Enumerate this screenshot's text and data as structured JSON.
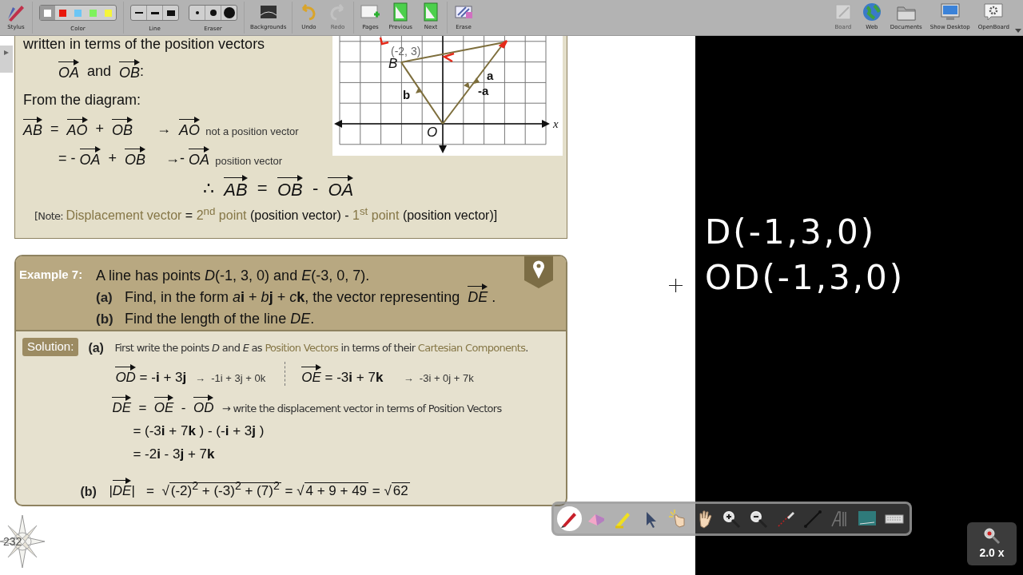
{
  "toolbar": {
    "left": [
      {
        "kind": "stylus",
        "label": "Stylus",
        "disabled": false
      },
      {
        "kind": "color",
        "label": "Color",
        "options": [
          {
            "color": "#ffffff",
            "selected": true
          },
          {
            "color": "#e8180c",
            "selected": false
          },
          {
            "color": "#6cc6f5",
            "selected": false
          },
          {
            "color": "#7ef25c",
            "selected": false
          },
          {
            "color": "#f5f53a",
            "selected": false
          }
        ]
      },
      {
        "kind": "line",
        "label": "Line"
      },
      {
        "kind": "eraser",
        "label": "Eraser"
      },
      {
        "kind": "backgrounds",
        "label": "Backgrounds",
        "disabled": false
      },
      {
        "kind": "undo",
        "label": "Undo",
        "disabled": false
      },
      {
        "kind": "redo",
        "label": "Redo",
        "disabled": true
      },
      {
        "kind": "pages",
        "label": "Pages",
        "disabled": false
      },
      {
        "kind": "previous",
        "label": "Previous",
        "disabled": false
      },
      {
        "kind": "next",
        "label": "Next",
        "disabled": false
      },
      {
        "kind": "erase",
        "label": "Erase",
        "disabled": false
      }
    ],
    "right": [
      {
        "kind": "board",
        "label": "Board",
        "disabled": true
      },
      {
        "kind": "web",
        "label": "Web",
        "disabled": false
      },
      {
        "kind": "documents",
        "label": "Documents",
        "disabled": false
      },
      {
        "kind": "desktop",
        "label": "Show Desktop",
        "disabled": false
      },
      {
        "kind": "openboard",
        "label": "OpenBoard",
        "disabled": false
      }
    ]
  },
  "card_top": {
    "lines": [
      {
        "kind": "plain",
        "parts": [
          {
            "kind": "text",
            "text": "written in terms of the position vectors"
          }
        ]
      },
      {
        "kind": "indented",
        "parts": [
          {
            "kind": "vec",
            "text": "OA"
          },
          {
            "kind": "text",
            "text": "  and  "
          },
          {
            "kind": "vec",
            "text": "OB"
          },
          {
            "kind": "text",
            "text": ":"
          }
        ]
      },
      {
        "kind": "plain",
        "parts": [
          {
            "kind": "text",
            "text": "From the diagram:"
          }
        ]
      },
      {
        "kind": "plain",
        "parts": [
          {
            "kind": "vec",
            "text": "AB"
          },
          {
            "kind": "text",
            "text": "  =  "
          },
          {
            "kind": "vec",
            "text": "AO"
          },
          {
            "kind": "text",
            "text": "  +  "
          },
          {
            "kind": "vec",
            "text": "OB"
          },
          {
            "kind": "text",
            "text": "      →  "
          },
          {
            "kind": "vec",
            "text": "AO"
          },
          {
            "kind": "small",
            "text": "  not a position vector"
          }
        ]
      },
      {
        "kind": "indented",
        "parts": [
          {
            "kind": "text",
            "text": "= - "
          },
          {
            "kind": "vec",
            "text": "OA"
          },
          {
            "kind": "text",
            "text": "  +  "
          },
          {
            "kind": "vec",
            "text": "OB"
          },
          {
            "kind": "text",
            "text": "     →- "
          },
          {
            "kind": "vec",
            "text": "OA"
          },
          {
            "kind": "small",
            "text": "  position vector"
          }
        ]
      },
      {
        "kind": "conclusion",
        "parts": [
          {
            "kind": "text",
            "text": "∴  "
          },
          {
            "kind": "vec",
            "text": "AB"
          },
          {
            "kind": "text",
            "text": "  =  "
          },
          {
            "kind": "vec",
            "text": "OB"
          },
          {
            "kind": "text",
            "text": "  -  "
          },
          {
            "kind": "vec",
            "text": "OA"
          }
        ]
      },
      {
        "kind": "note",
        "parts": [
          {
            "kind": "cond",
            "text": "[Note: "
          },
          {
            "kind": "accent",
            "text": "Displacement vector"
          },
          {
            "kind": "text",
            "text": " = "
          },
          {
            "kind": "accent",
            "text": "2$^{nd}$ point"
          },
          {
            "kind": "text",
            "text": " (position vector) - "
          },
          {
            "kind": "accent",
            "text": "1$^{st}$ point"
          },
          {
            "kind": "text",
            "text": " (position vector)]"
          }
        ]
      }
    ]
  },
  "diagram": {
    "point_b_coords": "(-2, 3)",
    "point_b": "B",
    "vector_b": "b",
    "vector_a": "a",
    "vector_neg_a": "-a",
    "origin": "O",
    "x_axis": "x"
  },
  "example": {
    "label": "Example 7:",
    "lines": [
      {
        "parts": [
          {
            "kind": "text",
            "text": "A line has points *D*(-1, 3, 0) and *E*(-3, 0, 7)."
          }
        ]
      },
      {
        "label": "(a)",
        "parts": [
          {
            "kind": "text",
            "text": "Find, in the form *a*"
          },
          {
            "kind": "text",
            "text": "**i** + *b*"
          },
          {
            "kind": "text",
            "text": "**j** + *c*"
          },
          {
            "kind": "text",
            "text": "**k**, the vector representing  "
          },
          {
            "kind": "vec",
            "text": "DE"
          },
          {
            "kind": "text",
            "text": " ."
          }
        ]
      },
      {
        "label": "(b)",
        "parts": [
          {
            "kind": "text",
            "text": "Find the length of the line *DE*."
          }
        ]
      }
    ]
  },
  "solution": {
    "label": "Solution:",
    "lines": [
      {
        "kind": "labeled",
        "label": "(a)",
        "parts": [
          {
            "kind": "cond",
            "text": "First write the points *D* and *E* as "
          },
          {
            "kind": "term",
            "text": "Position Vectors"
          },
          {
            "kind": "cond",
            "text": " in terms of their "
          },
          {
            "kind": "term",
            "text": "Cartesian Components"
          },
          {
            "kind": "cond",
            "text": "."
          }
        ]
      },
      {
        "kind": "split",
        "left": [
          {
            "kind": "vec",
            "text": "OD"
          },
          {
            "kind": "text",
            "text": " = -**i** + 3**j**"
          },
          {
            "kind": "small",
            "text": "   →  -1i + 3j + 0k"
          }
        ],
        "right": [
          {
            "kind": "vec",
            "text": "OE"
          },
          {
            "kind": "text",
            "text": " = -3**i** + 7**k**"
          },
          {
            "kind": "small",
            "text": "       →  -3i + 0j + 7k"
          }
        ]
      },
      {
        "kind": "plain",
        "parts": [
          {
            "kind": "vec",
            "text": "DE"
          },
          {
            "kind": "text",
            "text": "  =  "
          },
          {
            "kind": "vec",
            "text": "OE"
          },
          {
            "kind": "text",
            "text": "  -  "
          },
          {
            "kind": "vec",
            "text": "OD"
          },
          {
            "kind": "cond",
            "text": "   → write the displacement vector in terms of Position Vectors"
          }
        ]
      },
      {
        "kind": "indented",
        "parts": [
          {
            "kind": "text",
            "text": "= (-3**i** + 7**k** ) - (-**i** + 3**j** )"
          }
        ]
      },
      {
        "kind": "indented",
        "parts": [
          {
            "kind": "text",
            "text": "= -2**i** - 3**j** + 7**k**"
          }
        ]
      },
      {
        "kind": "labeled",
        "label": "(b)",
        "parts": [
          {
            "kind": "text",
            "text": "|"
          },
          {
            "kind": "vec",
            "text": "DE"
          },
          {
            "kind": "text",
            "text": "|   =  "
          },
          {
            "kind": "text",
            "text": "√"
          },
          {
            "kind": "radicand",
            "text": "(-2)$^{2}$ + (-3)$^{2}$ + (7)$^{2}$"
          },
          {
            "kind": "text",
            "text": " = "
          },
          {
            "kind": "text",
            "text": "√"
          },
          {
            "kind": "radicand",
            "text": "4 + 9 + 49"
          },
          {
            "kind": "text",
            "text": " = "
          },
          {
            "kind": "text",
            "text": "√"
          },
          {
            "kind": "radicand",
            "text": "62"
          }
        ]
      }
    ]
  },
  "page_number": "232",
  "board": {
    "lines": [
      "D(-1,3,0)",
      "OD(-1,3,0)"
    ]
  },
  "tools": [
    {
      "kind": "pen",
      "selected": true
    },
    {
      "kind": "eraser",
      "selected": false
    },
    {
      "kind": "highlighter",
      "selected": false
    },
    {
      "kind": "pointer",
      "selected": false
    },
    {
      "kind": "play",
      "selected": false
    },
    {
      "kind": "hand",
      "selected": false
    },
    {
      "kind": "zoom-in",
      "selected": false
    },
    {
      "kind": "zoom-out",
      "selected": false
    },
    {
      "kind": "laser",
      "selected": false
    },
    {
      "kind": "line",
      "selected": false
    },
    {
      "kind": "text",
      "selected": false
    },
    {
      "kind": "capture",
      "selected": false
    },
    {
      "kind": "keyboard",
      "selected": false
    }
  ],
  "zoom": {
    "label": "2.0 x"
  }
}
